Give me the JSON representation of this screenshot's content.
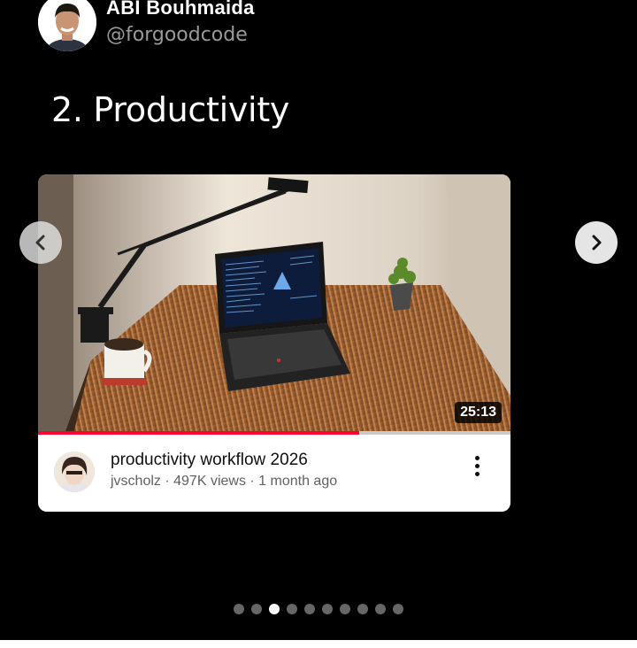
{
  "author": {
    "name": "ABI Bouhmaida",
    "handle": "@forgoodcode"
  },
  "slide": {
    "title": "2. Productivity"
  },
  "video": {
    "duration": "25:13",
    "progress_fraction": 0.68,
    "title": "productivity workflow 2026",
    "meta": "jvscholz · 497K views · 1 month ago"
  },
  "carousel": {
    "prev_icon": "chevron-left-icon",
    "next_icon": "chevron-right-icon",
    "dot_count": 10,
    "active_dot": 2
  },
  "colors": {
    "background": "#000000",
    "progress": "#ff0033"
  }
}
